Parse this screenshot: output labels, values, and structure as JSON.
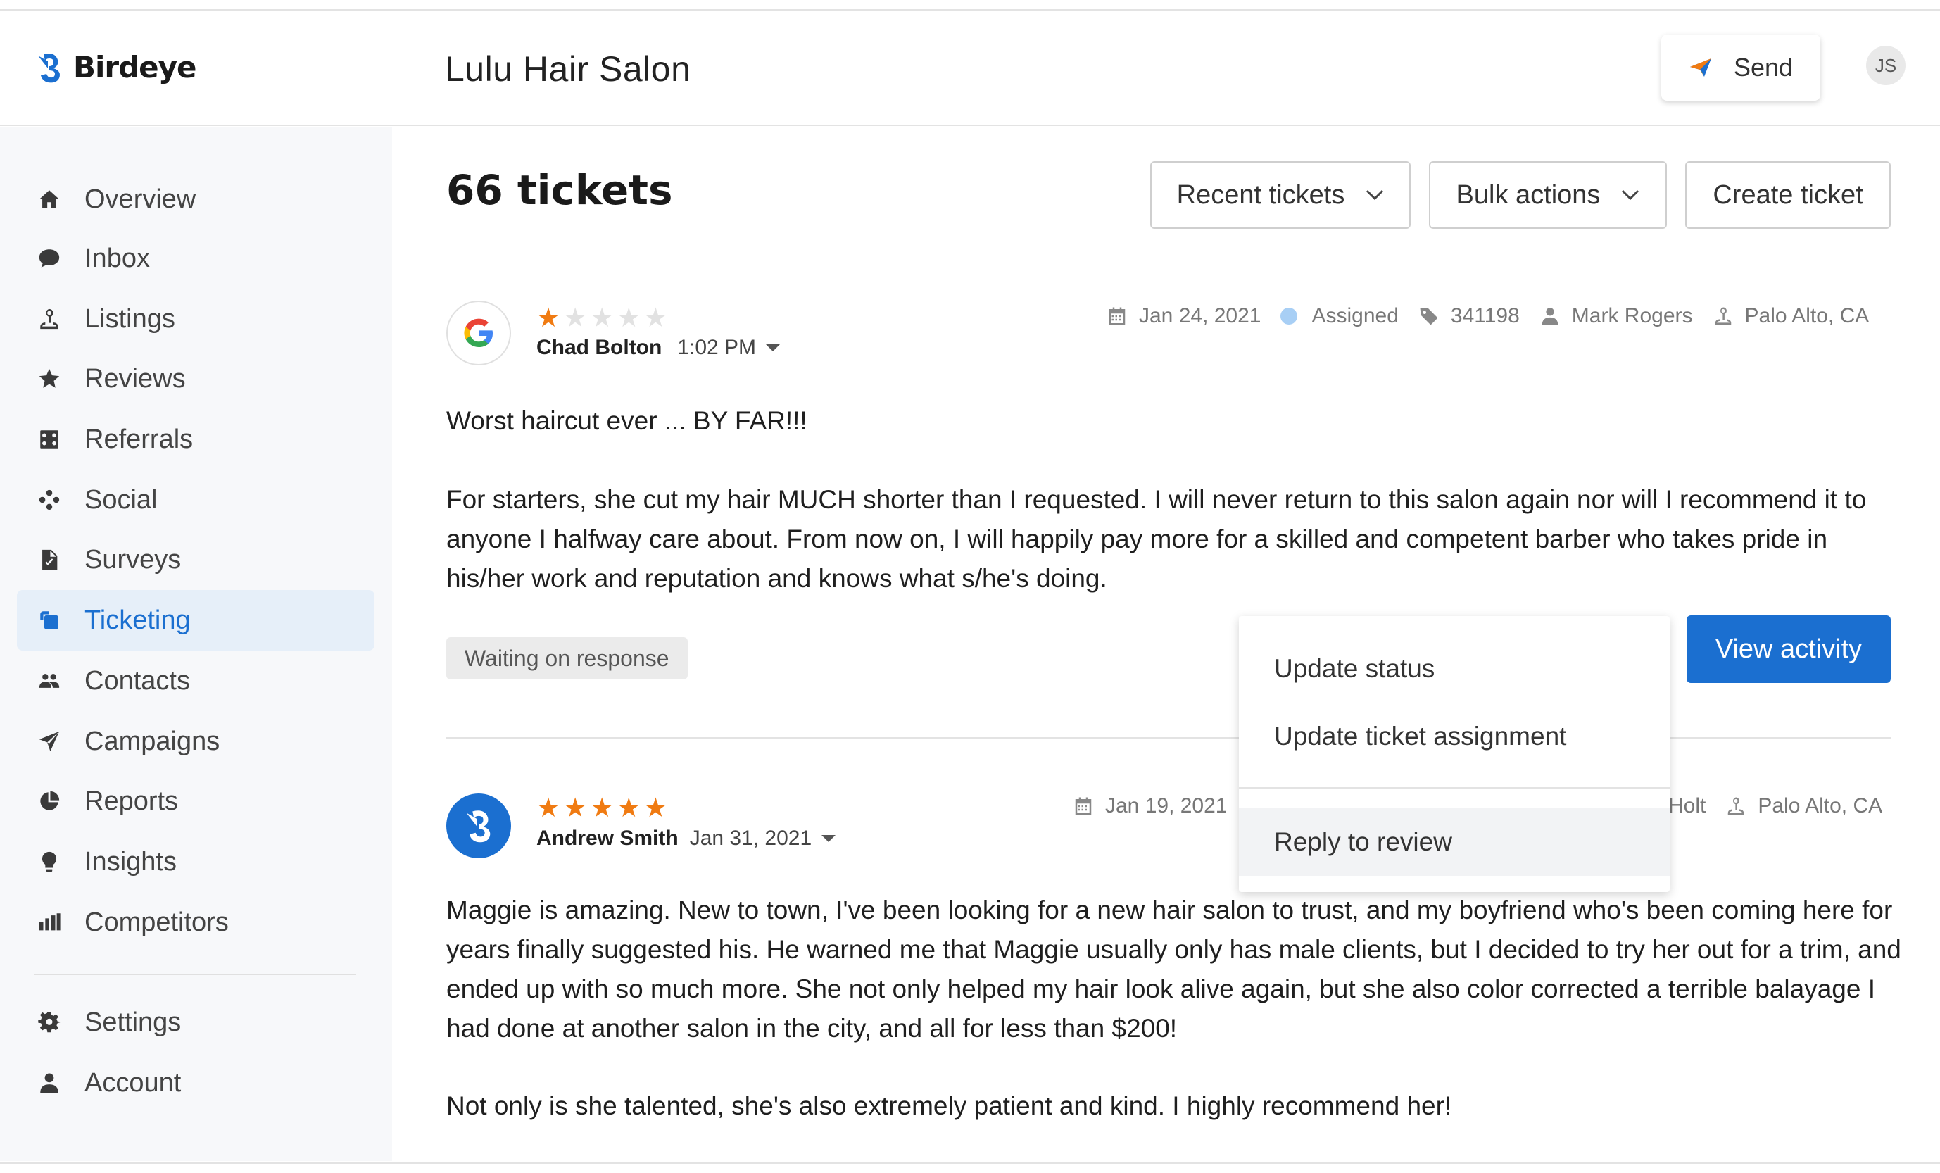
{
  "app": {
    "name": "Birdeye"
  },
  "header": {
    "title": "Lulu Hair Salon",
    "send_label": "Send",
    "avatar_initials": "JS"
  },
  "sidebar": {
    "items": [
      {
        "label": "Overview",
        "icon": "home-icon"
      },
      {
        "label": "Inbox",
        "icon": "chat-bubble-icon"
      },
      {
        "label": "Listings",
        "icon": "map-pin-icon"
      },
      {
        "label": "Reviews",
        "icon": "star-icon"
      },
      {
        "label": "Referrals",
        "icon": "referrals-icon"
      },
      {
        "label": "Social",
        "icon": "social-network-icon"
      },
      {
        "label": "Surveys",
        "icon": "survey-document-icon"
      },
      {
        "label": "Ticketing",
        "icon": "ticketing-icon",
        "active": true
      },
      {
        "label": "Contacts",
        "icon": "contacts-icon"
      },
      {
        "label": "Campaigns",
        "icon": "paper-plane-icon"
      },
      {
        "label": "Reports",
        "icon": "pie-chart-icon"
      },
      {
        "label": "Insights",
        "icon": "lightbulb-icon"
      },
      {
        "label": "Competitors",
        "icon": "bar-chart-icon"
      }
    ],
    "bottom_items": [
      {
        "label": "Settings",
        "icon": "gear-icon"
      },
      {
        "label": "Account",
        "icon": "user-icon"
      }
    ]
  },
  "main": {
    "title": "66 tickets",
    "recent_label": "Recent tickets",
    "bulk_label": "Bulk actions",
    "create_label": "Create ticket"
  },
  "tickets": [
    {
      "source": "google-icon",
      "rating": 1,
      "reviewer": "Chad Bolton",
      "time": "1:02 PM",
      "date": "Jan 24, 2021",
      "status_meta": "Assigned",
      "ticket_id": "341198",
      "assignee": "Mark Rogers",
      "location": "Palo Alto, CA",
      "headline": "Worst haircut ever ... BY FAR!!!",
      "body": "For starters, she cut my hair MUCH shorter than I requested. I will never return to this salon again nor will I recommend it to anyone I halfway care about. From now on, I will happily pay more for a skilled and competent barber who takes pride in his/her work and reputation and knows what s/he's doing.",
      "status_badge": "Waiting on response",
      "action_label": "View activity"
    },
    {
      "source": "birdeye-icon",
      "rating": 5,
      "reviewer": "Andrew Smith",
      "time": "Jan 31, 2021",
      "date": "Jan 19, 2021",
      "assignee_partial": "Holt",
      "location": "Palo Alto, CA",
      "body": "Maggie is amazing. New to town, I've been looking for a new hair salon to trust, and my boyfriend who's been coming here for years finally suggested his. He warned me that Maggie usually only has male clients, but I decided to try her out for a trim, and ended up with so much more. She not only helped my hair look alive again, but she also color corrected a terrible balayage I had done at another salon in the city, and all for less than $200!",
      "body2": "Not only is she talented, she's also extremely patient and kind. I highly recommend her!"
    }
  ],
  "dropdown": {
    "items": [
      "Update status",
      "Update ticket assignment",
      "Reply to review"
    ]
  },
  "colors": {
    "accent": "#1b6fd0",
    "star": "#f07b12",
    "assigned_dot": "#a8cff5"
  }
}
